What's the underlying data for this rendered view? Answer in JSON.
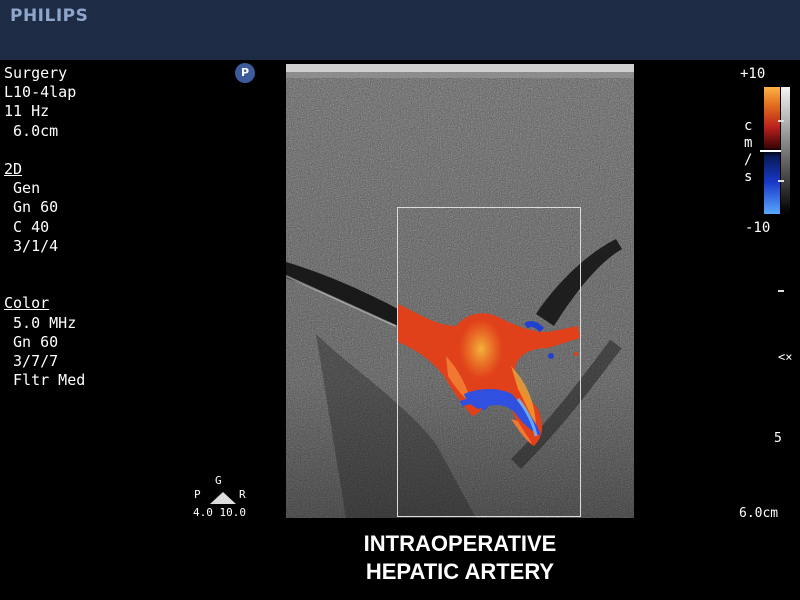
{
  "header": {
    "brand": "PHILIPS"
  },
  "params": {
    "lines": [
      {
        "text": "Surgery",
        "underline": false
      },
      {
        "text": "L10-4lap",
        "underline": false
      },
      {
        "text": "11 Hz",
        "underline": false
      },
      {
        "text": " 6.0cm",
        "underline": false
      },
      {
        "text": "",
        "underline": false
      },
      {
        "text": "2D",
        "underline": true
      },
      {
        "text": " Gen",
        "underline": false
      },
      {
        "text": " Gn 60",
        "underline": false
      },
      {
        "text": " C 40",
        "underline": false
      },
      {
        "text": " 3/1/4",
        "underline": false
      },
      {
        "text": "",
        "underline": false
      },
      {
        "text": "",
        "underline": false
      },
      {
        "text": "Color",
        "underline": true
      },
      {
        "text": " 5.0 MHz",
        "underline": false
      },
      {
        "text": " Gn 60",
        "underline": false
      },
      {
        "text": " 3/7/7",
        "underline": false
      },
      {
        "text": " Fltr Med",
        "underline": false
      }
    ]
  },
  "badge": {
    "label": "P"
  },
  "velocity_scale": {
    "max": "+10",
    "min": "-10",
    "unit_letters": [
      "c",
      "m",
      "/",
      "s"
    ]
  },
  "depth": {
    "marker": "5",
    "total": "6.0cm",
    "focus_marker": "<×"
  },
  "orientation": {
    "top": "G",
    "left": "P",
    "right": "R",
    "values": "4.0 10.0"
  },
  "caption": {
    "line1": "INTRAOPERATIVE",
    "line2": "HEPATIC  ARTERY"
  },
  "colors": {
    "panel": "#1e2b45",
    "brand": "#8fa6cc",
    "flow_red": "#e0401a",
    "flow_orange": "#f5a030",
    "flow_blue": "#3050e0"
  }
}
